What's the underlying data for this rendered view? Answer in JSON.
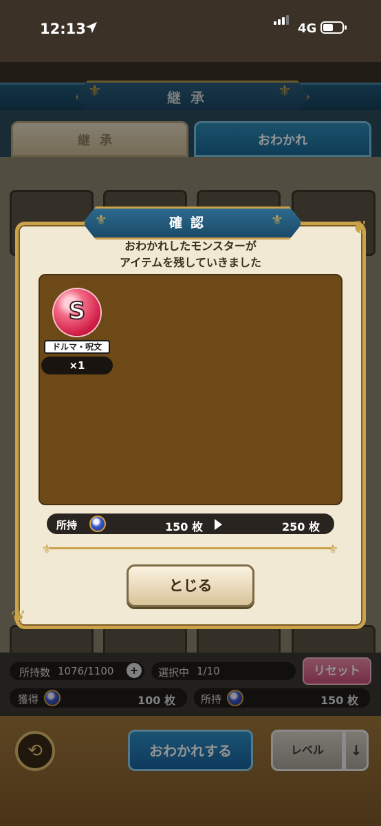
{
  "status": {
    "time": "12:13",
    "network": "4G"
  },
  "header": {
    "title": "継承"
  },
  "tabs": [
    {
      "label": "継承"
    },
    {
      "label": "おわかれ"
    }
  ],
  "inventory": {
    "owned_label": "所持数",
    "owned_value": "1076/1100",
    "selected_label": "選択中",
    "selected_value": "1/10",
    "reset_label": "リセット",
    "gain_label": "獲得",
    "gain_value": "100 枚",
    "have_label": "所持",
    "have_value": "150 枚"
  },
  "footer": {
    "farewell_label": "おわかれする",
    "level_label": "レベル",
    "sort_icon": "down-arrow"
  },
  "dialog": {
    "title": "確認",
    "message_line1": "おわかれしたモンスターが",
    "message_line2": "アイテムを残していきました",
    "item": {
      "icon_letter": "S",
      "name": "ドルマ・呪文",
      "qty": "×1",
      "color": "#d11d46"
    },
    "owned_label": "所持",
    "owned_from": "150 枚",
    "owned_to": "250 枚",
    "close_label": "とじる"
  },
  "colors": {
    "accent": "#1f6fa0",
    "gold": "#c9a24a",
    "panel": "#6e4918"
  }
}
